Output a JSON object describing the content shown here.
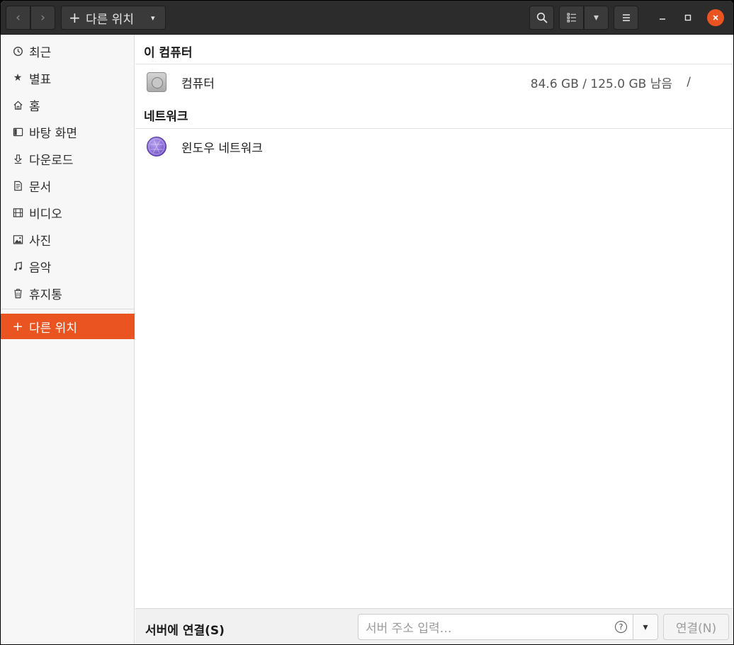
{
  "header": {
    "back_icon": "‹",
    "forward_icon": "›",
    "path_label": "다른 위치",
    "path_plus": "+",
    "dropdown_arrow": "▾"
  },
  "sidebar": {
    "items": [
      {
        "label": "최근",
        "icon": "clock-icon"
      },
      {
        "label": "별표",
        "icon": "star-icon"
      },
      {
        "label": "홈",
        "icon": "home-icon"
      },
      {
        "label": "바탕 화면",
        "icon": "desktop-icon"
      },
      {
        "label": "다운로드",
        "icon": "download-icon"
      },
      {
        "label": "문서",
        "icon": "document-icon"
      },
      {
        "label": "비디오",
        "icon": "video-icon"
      },
      {
        "label": "사진",
        "icon": "picture-icon"
      },
      {
        "label": "음악",
        "icon": "music-icon"
      },
      {
        "label": "휴지통",
        "icon": "trash-icon"
      }
    ],
    "other_locations": {
      "label": "다른 위치",
      "icon": "plus-icon"
    }
  },
  "main": {
    "this_computer": {
      "title": "이 컴퓨터",
      "entries": [
        {
          "name": "컴퓨터",
          "space": "84.6 GB / 125.0 GB 남음",
          "mount": "/"
        }
      ]
    },
    "network": {
      "title": "네트워크",
      "entries": [
        {
          "name": "윈도우 네트워크"
        }
      ]
    }
  },
  "bottom": {
    "label": "서버에 연결(S)",
    "address_placeholder": "서버 주소 입력…",
    "help_glyph": "?",
    "connect_label": "연결(N)"
  },
  "colors": {
    "accent": "#e95420",
    "headerbar": "#2c2c2c"
  }
}
